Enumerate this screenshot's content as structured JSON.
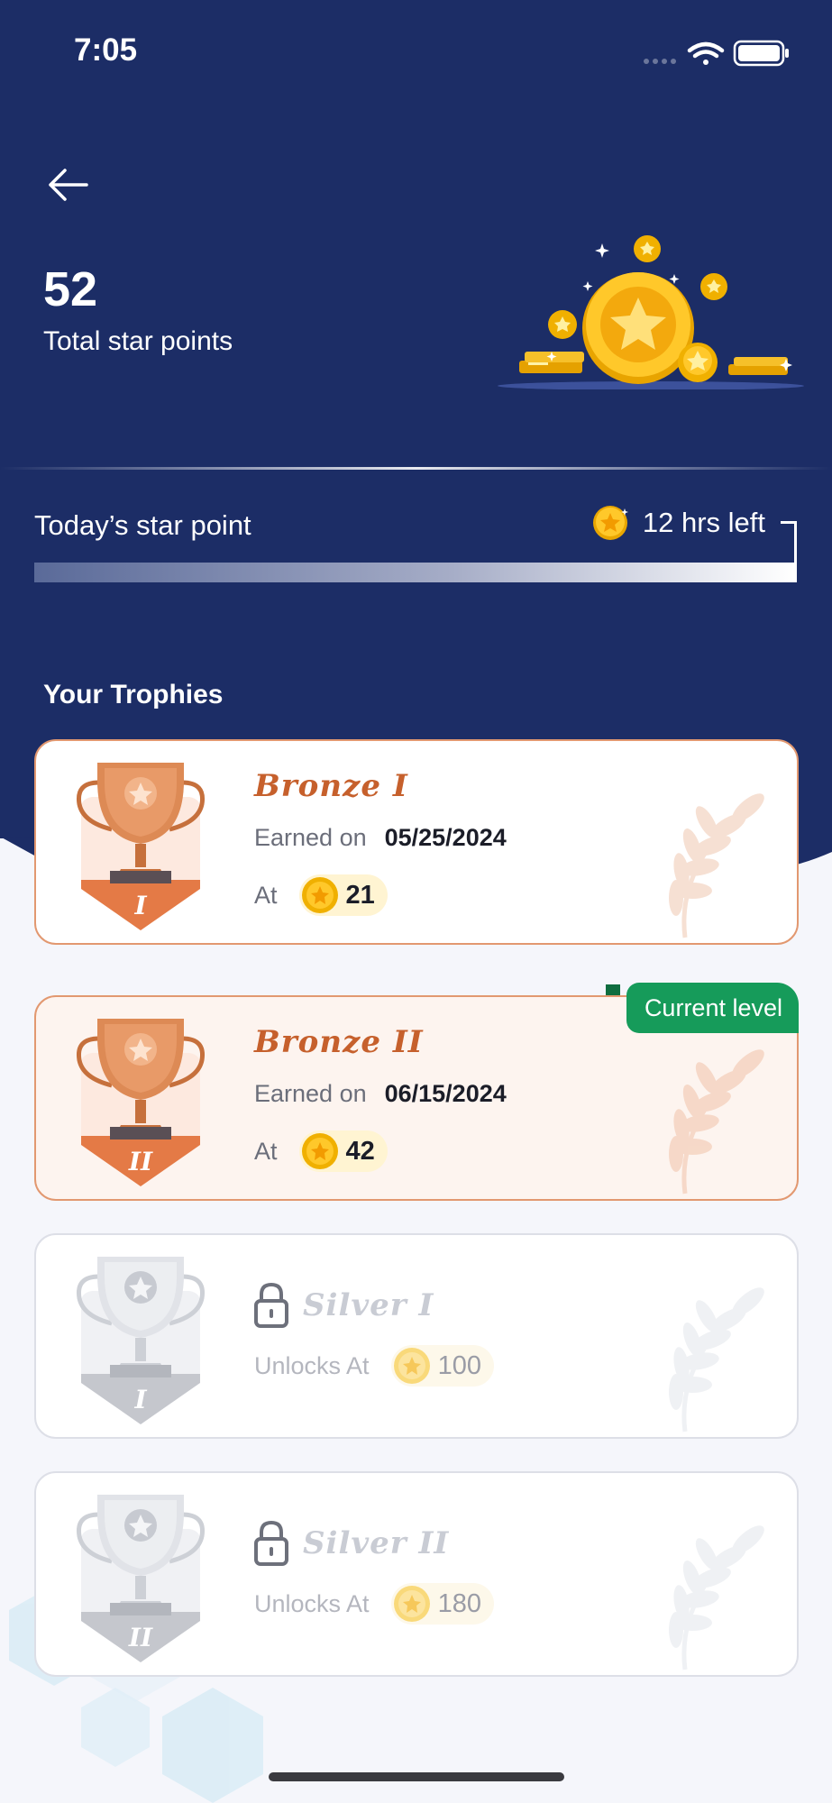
{
  "status_bar": {
    "time": "7:05"
  },
  "header": {
    "total_points": "52",
    "total_label": "Total star points",
    "today_label": "Today’s star point",
    "time_left": "12 hrs left",
    "today_progress": 1.0
  },
  "trophies": {
    "section_title": "Your Trophies",
    "items": [
      {
        "name": "Bronze I",
        "tier": "bronze",
        "numeral": "I",
        "status": "earned",
        "earned_label": "Earned on",
        "date": "05/25/2024",
        "at_label": "At",
        "points": "21"
      },
      {
        "name": "Bronze II",
        "tier": "bronze",
        "numeral": "II",
        "status": "current",
        "earned_label": "Earned on",
        "date": "06/15/2024",
        "at_label": "At",
        "points": "42",
        "badge": "Current level"
      },
      {
        "name": "Silver I",
        "tier": "silver",
        "numeral": "I",
        "status": "locked",
        "unlock_label": "Unlocks At",
        "points": "100"
      },
      {
        "name": "Silver II",
        "tier": "silver",
        "numeral": "II",
        "status": "locked",
        "unlock_label": "Unlocks At",
        "points": "180"
      }
    ]
  },
  "colors": {
    "header_bg": "#1c2d66",
    "bronze": "#c6602c",
    "current_badge": "#169b5a",
    "coin": "#f5b800"
  },
  "icons": [
    "back-arrow-icon",
    "wifi-icon",
    "battery-icon",
    "star-coin-icon",
    "trophy-icon",
    "laurel-icon",
    "lock-icon"
  ]
}
